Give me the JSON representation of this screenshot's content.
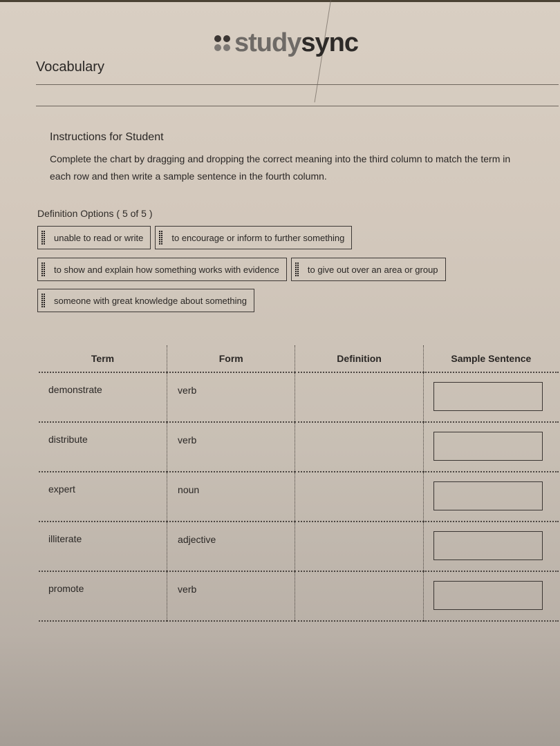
{
  "brand": {
    "logo_part1": "study",
    "logo_part2": "sync",
    "logo_icon": "four-dots-icon"
  },
  "page": {
    "title": "Vocabulary"
  },
  "instructions": {
    "title": "Instructions for Student",
    "body": "Complete the chart by dragging and dropping the correct meaning into the third column to match the term in each row and then write a sample sentence in the fourth column."
  },
  "definition_options": {
    "label": "Definition Options ( 5 of 5 )",
    "drag_handle_icon": "grip-dots-icon",
    "items": [
      {
        "label": "unable to read or write"
      },
      {
        "label": "to encourage or inform to further something"
      },
      {
        "label": "to show and explain how something works with evidence"
      },
      {
        "label": "to give out over an area or group"
      },
      {
        "label": "someone with great knowledge about something"
      }
    ]
  },
  "table": {
    "headers": [
      "Term",
      "Form",
      "Definition",
      "Sample Sentence"
    ],
    "rows": [
      {
        "term": "demonstrate",
        "form": "verb",
        "definition": "",
        "sentence": ""
      },
      {
        "term": "distribute",
        "form": "verb",
        "definition": "",
        "sentence": ""
      },
      {
        "term": "expert",
        "form": "noun",
        "definition": "",
        "sentence": ""
      },
      {
        "term": "illiterate",
        "form": "adjective",
        "definition": "",
        "sentence": ""
      },
      {
        "term": "promote",
        "form": "verb",
        "definition": "",
        "sentence": ""
      }
    ]
  }
}
